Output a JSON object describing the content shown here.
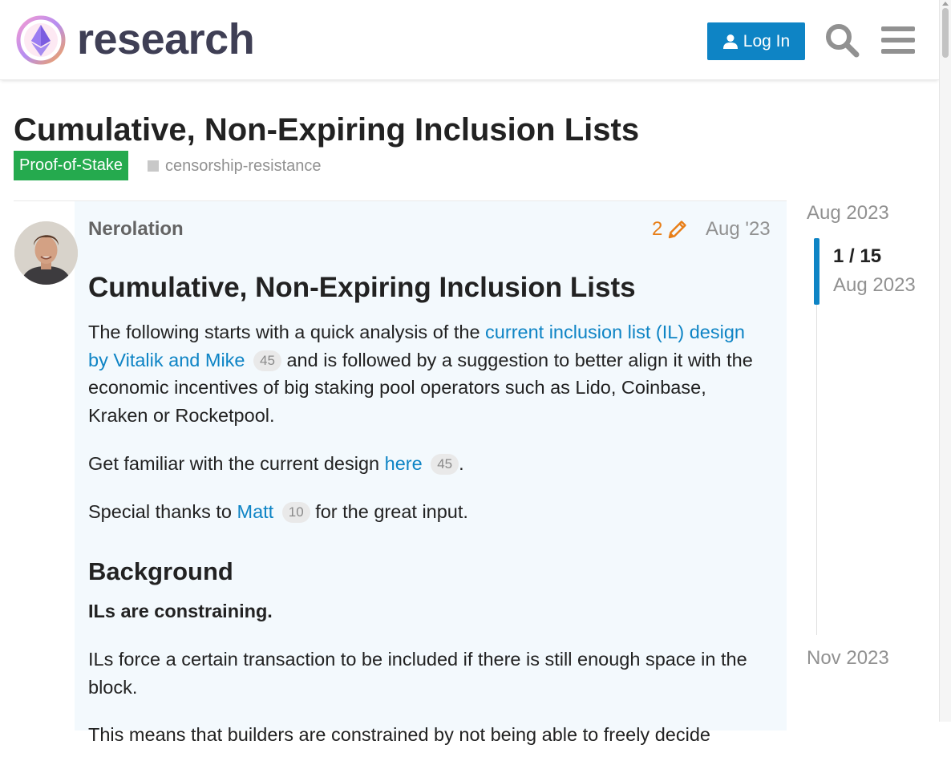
{
  "header": {
    "site_name": "research",
    "login_label": "Log In",
    "icons": [
      "ethereum-logo",
      "user-icon",
      "search-icon",
      "hamburger-menu-icon"
    ]
  },
  "topic": {
    "title": "Cumulative, Non-Expiring Inclusion Lists",
    "category": "Proof-of-Stake",
    "tag": "censorship-resistance"
  },
  "post": {
    "username": "Nerolation",
    "edit_count": "2",
    "date": "Aug '23",
    "heading": "Cumulative, Non-Expiring Inclusion Lists",
    "p1_before": "The following starts with a quick analysis of the ",
    "p1_link": "current inclusion list (IL) design by Vitalik and Mike",
    "p1_link_count": "45",
    "p1_after": " and is followed by a suggestion to better align it with the economic incentives of big staking pool operators such as Lido, Coinbase, Kraken or Rocketpool.",
    "p2_before": "Get familiar with the current design ",
    "p2_link": "here",
    "p2_link_count": "45",
    "p2_after": ".",
    "p3_before": "Special thanks to ",
    "p3_link": "Matt",
    "p3_link_count": "10",
    "p3_after": " for the great input.",
    "section_heading": "Background",
    "bold_line": "ILs are constraining.",
    "p4": "ILs force a certain transaction to be included if there is still enough space in the block.",
    "p5_partial": "This means that builders are constrained by not being able to freely decide"
  },
  "timeline": {
    "start_label": "Aug 2023",
    "position": "1 / 15",
    "position_date": "Aug 2023",
    "end_label": "Nov 2023"
  },
  "colors": {
    "accent_blue": "#0e84c5",
    "category_green": "#25aa4e",
    "edit_orange": "#e87e17",
    "post_highlight_bg": "#f3f9fd"
  }
}
